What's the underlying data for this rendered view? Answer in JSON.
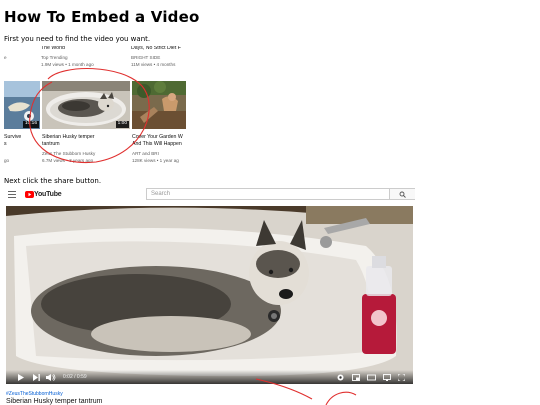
{
  "article": {
    "title": "How To Embed a Video",
    "step1_text": "First you need to find the video you want.",
    "step2_text": "Next click the share button."
  },
  "grid": {
    "top_row": [
      {
        "title": "The World",
        "channel": "Top Trending",
        "meta": "1.9M views • 1 month ago"
      },
      {
        "title": "Days, No Strict Diet F",
        "channel": "BRIGHT SIDE",
        "meta": "11M views • 4 months"
      }
    ],
    "left_partial": {
      "title_line1": "Survive",
      "title_line2": "s",
      "meta": "go",
      "duration": "10:16"
    },
    "videos": [
      {
        "title_line1": "Siberian Husky temper",
        "title_line2": "tantrum",
        "channel": "Zeus The Stubborn Husky",
        "meta": "6.7M views • 3 years ago",
        "duration": "1:00"
      },
      {
        "title_line1": "Cover Your Garden W",
        "title_line2": "And This Will Happen",
        "channel": "ART and BRI",
        "meta": "128K views • 1 year ag"
      }
    ]
  },
  "youtube": {
    "logo": "YouTube",
    "search_placeholder": "Search",
    "time": "0:02 / 0:59",
    "hashtag": "#ZeusTheStubbornHusky",
    "video_title": "Siberian Husky temper tantrum"
  },
  "colors": {
    "annotation_red": "#e0302f",
    "youtube_red": "#ff0000",
    "link_blue": "#065fd4"
  },
  "icons": [
    "menu-icon",
    "youtube-logo-icon",
    "search-icon",
    "play-icon",
    "next-icon",
    "volume-icon",
    "settings-icon",
    "miniplayer-icon",
    "theater-icon",
    "cast-icon",
    "fullscreen-icon"
  ]
}
